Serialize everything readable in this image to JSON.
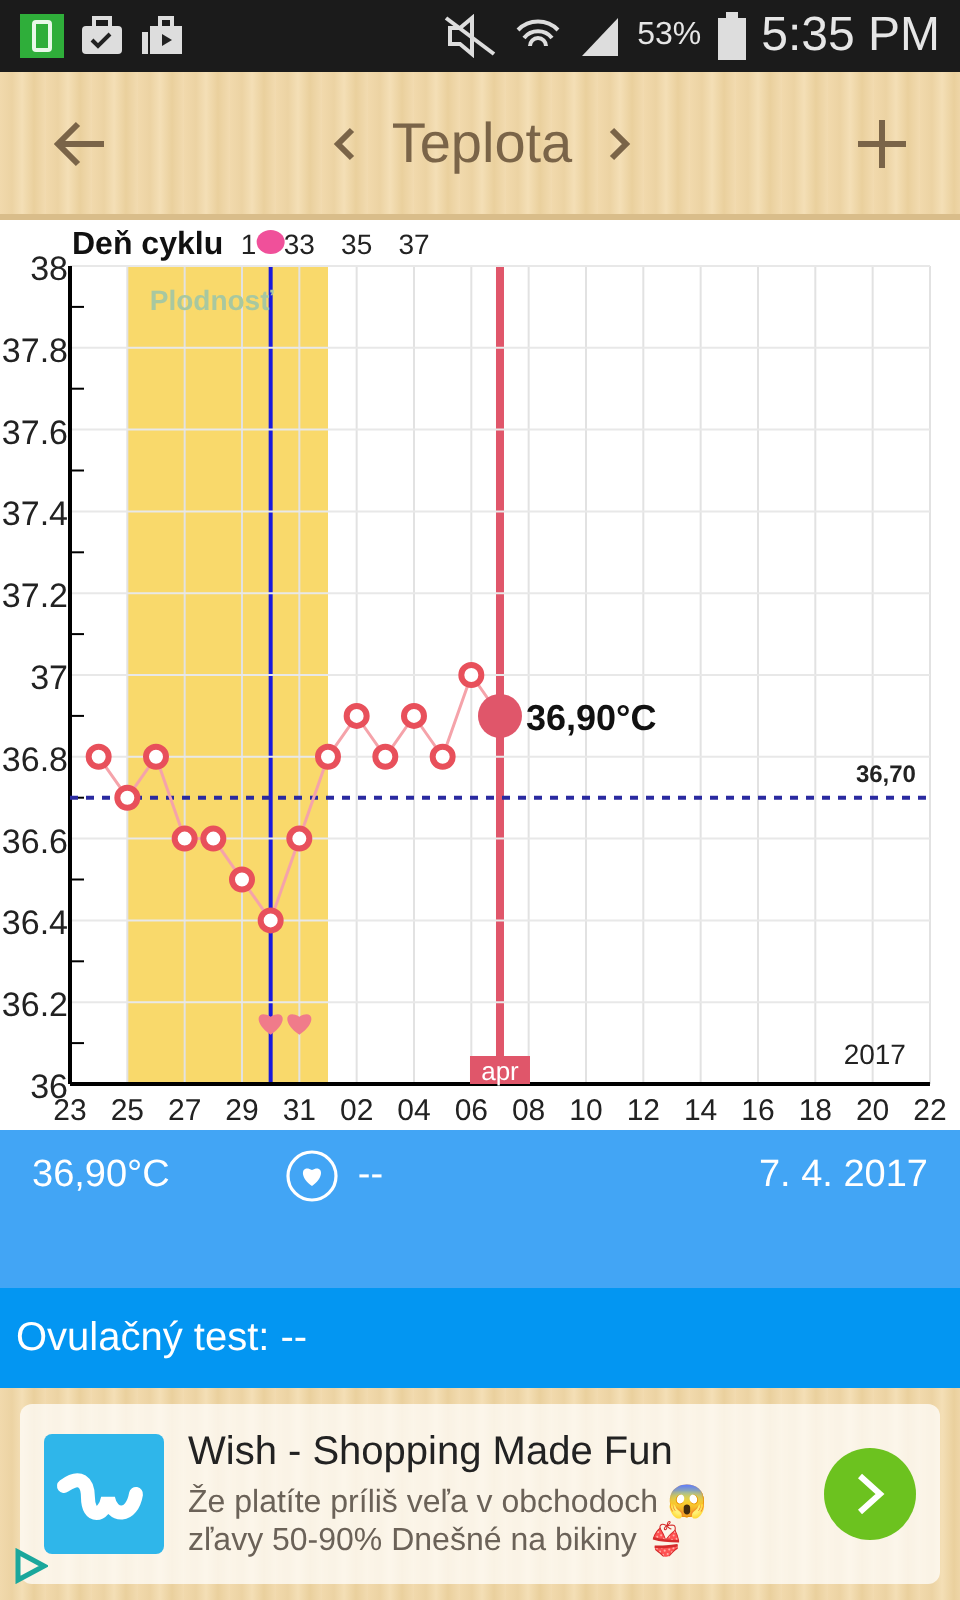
{
  "status_bar": {
    "battery": "53%",
    "time": "5:35 PM"
  },
  "toolbar": {
    "title": "Teplota"
  },
  "chart": {
    "fertile_label": "Plodnosť",
    "cycle_title": "Deň cyklu",
    "cycle_ticks": [
      "1",
      "33",
      "35",
      "37"
    ],
    "selected_value": "36,90°C",
    "month_label": "apr",
    "year_label": "2017",
    "chart_data": {
      "type": "line",
      "grid": true,
      "ref_lines": [
        {
          "axis": "y",
          "value": 36.7,
          "label": "36,70",
          "color": "#2a2aa0"
        }
      ],
      "categories": [
        "23",
        null,
        "25",
        null,
        "27",
        null,
        "29",
        null,
        "31",
        null,
        "02",
        null,
        "04",
        null,
        "06",
        null,
        "08",
        null,
        "10",
        null,
        "12",
        null,
        "14",
        null,
        "16",
        null,
        "18",
        null,
        "20",
        null,
        "22"
      ],
      "series": [
        {
          "color": "#e8505b",
          "marker": "o",
          "values": [
            null,
            36.8,
            36.7,
            36.8,
            36.6,
            36.6,
            36.5,
            36.4,
            36.6,
            36.8,
            36.9,
            36.8,
            36.9,
            36.8,
            37.0,
            36.9,
            null,
            null,
            null,
            null,
            null,
            null,
            null,
            null,
            null,
            null,
            null,
            null,
            null,
            null,
            null
          ]
        }
      ],
      "ylim": [
        36,
        38
      ],
      "yticks": [
        {
          "value": 36,
          "label": "36"
        },
        {
          "value": 36.2,
          "label": "36.2"
        },
        {
          "value": 36.4,
          "label": "36.4"
        },
        {
          "value": 36.6,
          "label": "36.6"
        },
        {
          "value": 36.8,
          "label": "36.8"
        },
        {
          "value": 37,
          "label": "37"
        },
        {
          "value": 37.2,
          "label": "37.2"
        },
        {
          "value": 37.4,
          "label": "37.4"
        },
        {
          "value": 37.6,
          "label": "37.6"
        },
        {
          "value": 37.8,
          "label": "37.8"
        },
        {
          "value": 38,
          "label": "38"
        }
      ]
    }
  },
  "summary": {
    "temperature": "36,90°C",
    "sex": "--",
    "date": "7. 4. 2017"
  },
  "ovulation": {
    "text": "Ovulačný test: --"
  },
  "ad": {
    "title": "Wish - Shopping Made Fun",
    "lines": [
      "Že platíte príliš veľa v obchodoch 😱",
      "zľavy 50-90% Dnešné na bikiny 👙"
    ]
  }
}
